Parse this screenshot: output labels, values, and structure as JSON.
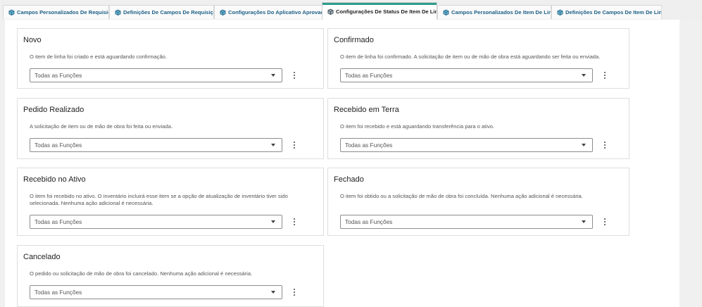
{
  "tabs": [
    {
      "label": "Campos Personalizados De Requisição",
      "active": false
    },
    {
      "label": "Definições De Campos De Requisição",
      "active": false
    },
    {
      "label": "Configurações Do Aplicativo Aprovação",
      "active": false
    },
    {
      "label": "Configurações De Status De Item De Linha",
      "active": true
    },
    {
      "label": "Campos Personalizados De Item De Linha",
      "active": false
    },
    {
      "label": "Definições De Campos De Item De Linha",
      "active": false
    }
  ],
  "statuses": [
    {
      "title": "Novo",
      "description": "O item de linha foi criado e está aguardando confirmação.",
      "role_select": "Todas as Funções"
    },
    {
      "title": "Confirmado",
      "description": "O item de linha foi confirmado. A solicitação de item ou de mão de obra está aguardando ser feita ou enviada.",
      "role_select": "Todas as Funções"
    },
    {
      "title": "Pedido Realizado",
      "description": "A solicitação de item ou de mão de obra foi feita ou enviada.",
      "role_select": "Todas as Funções"
    },
    {
      "title": "Recebido em Terra",
      "description": "O item foi recebido e está aguardando transferência para o ativo.",
      "role_select": "Todas as Funções"
    },
    {
      "title": "Recebido no Ativo",
      "description": "O item foi recebido no ativo. O inventário incluirá esse item se a opção de atualização de inventário tiver sido selecionada. Nenhuma ação adicional é necessária.",
      "role_select": "Todas as Funções"
    },
    {
      "title": "Fechado",
      "description": "O item foi obtido ou a solicitação de mão de obra foi concluída. Nenhuma ação adicional é necessária.",
      "role_select": "Todas as Funções"
    },
    {
      "title": "Cancelado",
      "description": "O pedido ou solicitação de mão de obra foi cancelado. Nenhuma ação adicional é necessária.",
      "role_select": "Todas as Funções"
    }
  ],
  "icons": {
    "tab_icon": "cube-icon",
    "select_chevron": "chevron-down-icon",
    "card_menu": "more-vertical-icon"
  },
  "colors": {
    "tab_text": "#1b5f86",
    "active_tab_accent": "#2e9c8c",
    "background": "#f0f0f0",
    "card_border": "#dedede"
  }
}
